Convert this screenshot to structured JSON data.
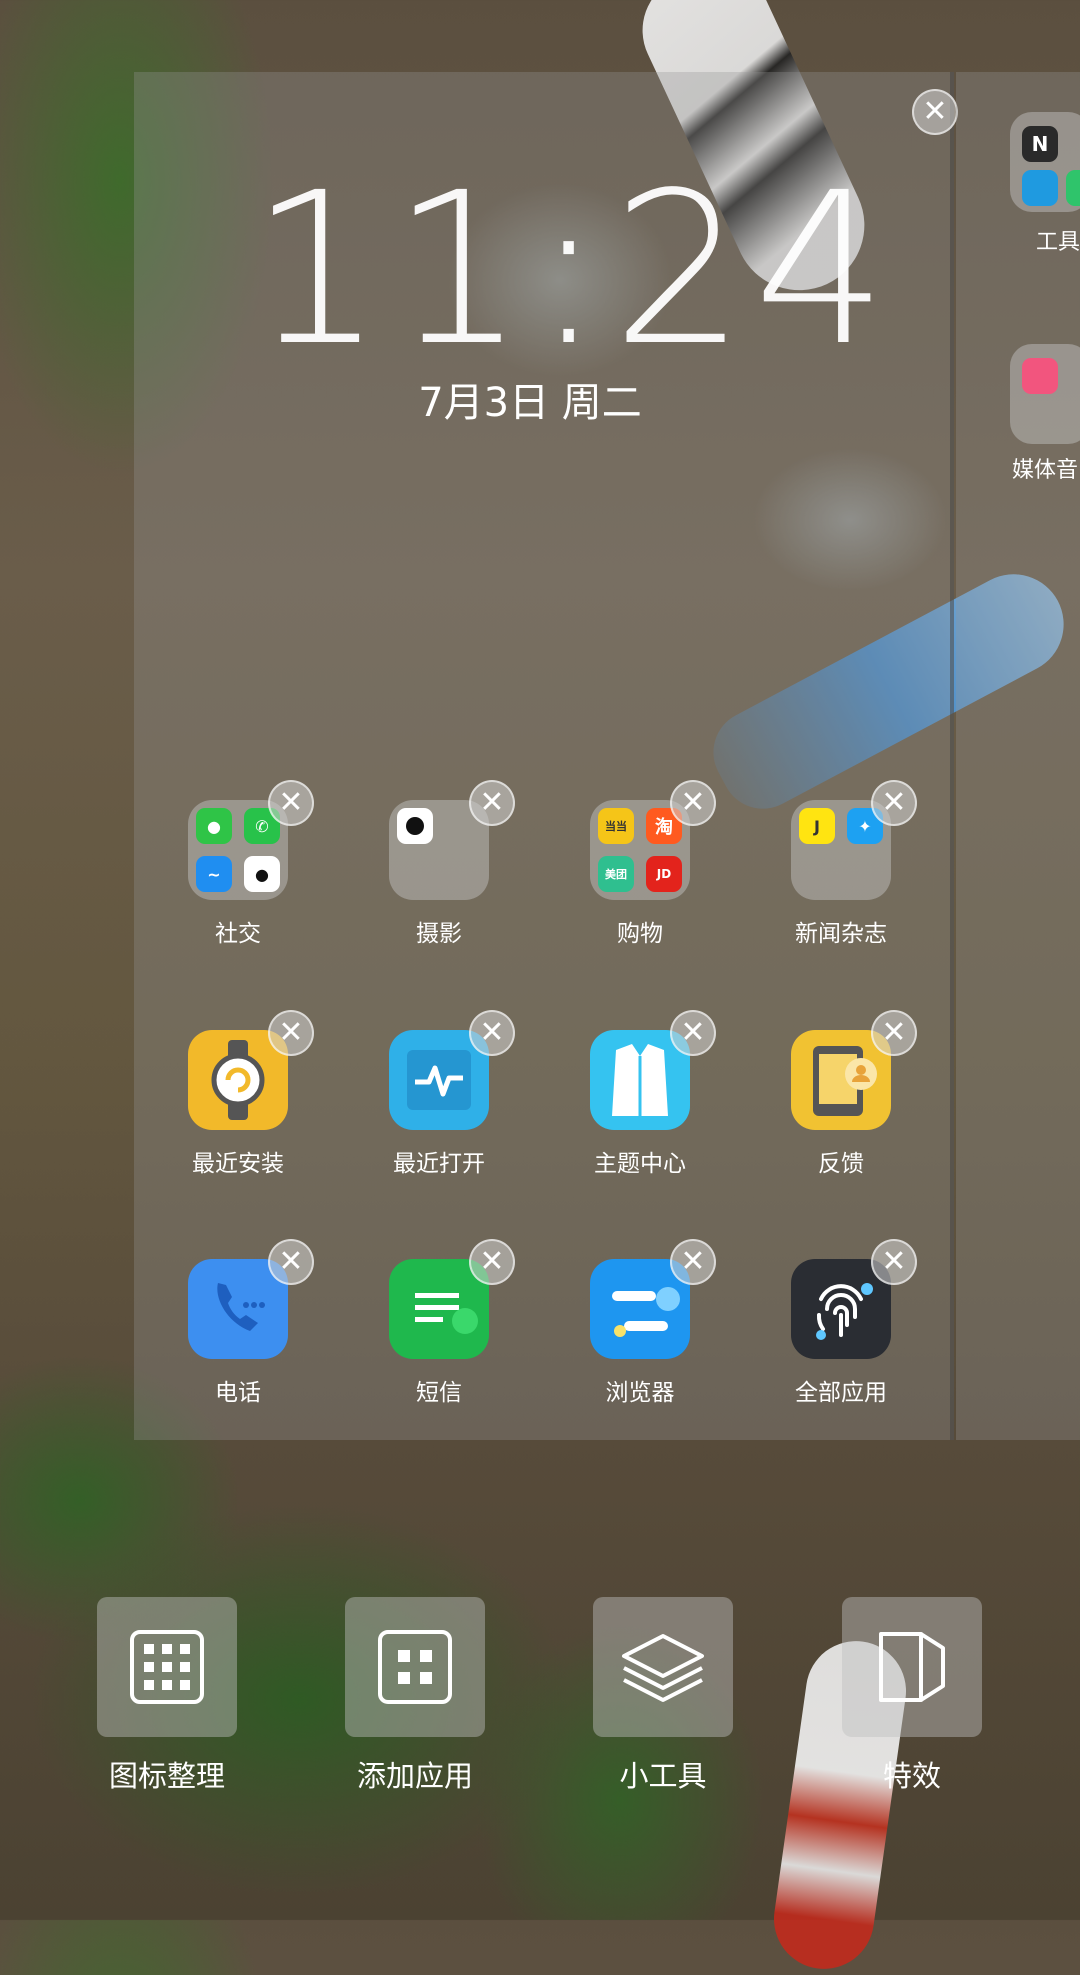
{
  "clock": {
    "time": "11:24",
    "date": "7月3日 周二"
  },
  "apps": [
    {
      "label": "社交",
      "kind": "folder"
    },
    {
      "label": "摄影",
      "kind": "folder"
    },
    {
      "label": "购物",
      "kind": "folder",
      "mini": [
        "当当",
        "淘",
        "美团",
        "JD"
      ]
    },
    {
      "label": "新闻杂志",
      "kind": "folder"
    },
    {
      "label": "最近安装",
      "icon": "watch-icon",
      "color": "#f2b92a"
    },
    {
      "label": "最近打开",
      "icon": "pulse-icon",
      "color": "#2fb0e8"
    },
    {
      "label": "主题中心",
      "icon": "shirt-icon",
      "color": "#35c3f0"
    },
    {
      "label": "反馈",
      "icon": "feedback-icon",
      "color": "#f1c232"
    },
    {
      "label": "电话",
      "icon": "phone-icon",
      "color": "#3d8ff0"
    },
    {
      "label": "短信",
      "icon": "message-icon",
      "color": "#1fb84d"
    },
    {
      "label": "浏览器",
      "icon": "browser-icon",
      "color": "#1e96f0"
    },
    {
      "label": "全部应用",
      "icon": "fingerprint-icon",
      "color": "#2a2d33"
    }
  ],
  "next_page": {
    "labels": [
      "工具",
      "媒体音"
    ]
  },
  "dock": [
    {
      "label": "图标整理",
      "icon": "grid-icon"
    },
    {
      "label": "添加应用",
      "icon": "add-app-icon"
    },
    {
      "label": "小工具",
      "icon": "layers-icon"
    },
    {
      "label": "特效",
      "icon": "effect-icon"
    }
  ]
}
